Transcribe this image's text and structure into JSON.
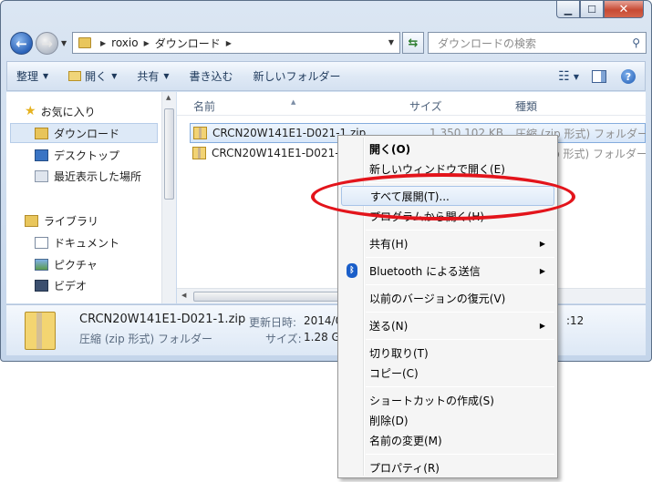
{
  "address": {
    "crumbs": [
      "roxio",
      "ダウンロード"
    ],
    "search_placeholder": "ダウンロードの検索"
  },
  "toolbar": {
    "organize": "整理",
    "open": "開く",
    "share": "共有",
    "burn": "書き込む",
    "new_folder": "新しいフォルダー"
  },
  "navpane": {
    "favorites": "お気に入り",
    "downloads": "ダウンロード",
    "desktop": "デスクトップ",
    "recent": "最近表示した場所",
    "libraries": "ライブラリ",
    "documents": "ドキュメント",
    "pictures": "ピクチャ",
    "videos": "ビデオ"
  },
  "columns": {
    "name": "名前",
    "size": "サイズ",
    "type": "種類"
  },
  "files": [
    {
      "name": "CRCN20W141E1-D021-1.zip",
      "size": "1,350,102 KB",
      "type": "圧縮 (zip 形式) フォルダー"
    },
    {
      "name": "CRCN20W141E1-D021-2",
      "size": "",
      "type": "圧縮 (zip 形式) フォルダー"
    }
  ],
  "details": {
    "name": "CRCN20W141E1-D021-1.zip",
    "type": "圧縮 (zip 形式) フォルダー",
    "modified_label": "更新日時:",
    "modified_value": "2014/0",
    "size_label": "サイズ:",
    "size_value": "1.28 G",
    "time_fragment": ":12"
  },
  "context_menu": {
    "open": "開く(O)",
    "open_new_window": "新しいウィンドウで開く(E)",
    "extract_all": "すべて展開(T)...",
    "open_with": "プログラムから開く(H)",
    "share_with": "共有(H)",
    "bluetooth": "Bluetooth による送信",
    "restore_versions": "以前のバージョンの復元(V)",
    "send_to": "送る(N)",
    "cut": "切り取り(T)",
    "copy": "コピー(C)",
    "create_shortcut": "ショートカットの作成(S)",
    "delete": "削除(D)",
    "rename": "名前の変更(M)",
    "properties": "プロパティ(R)"
  }
}
